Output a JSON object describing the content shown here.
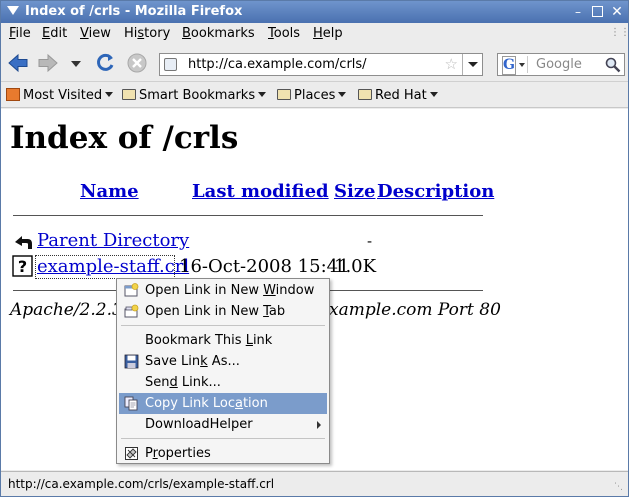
{
  "window": {
    "title": "Index of /crls - Mozilla Firefox"
  },
  "menubar": {
    "items": [
      {
        "pre": "",
        "acc": "F",
        "post": "ile"
      },
      {
        "pre": "",
        "acc": "E",
        "post": "dit"
      },
      {
        "pre": "",
        "acc": "V",
        "post": "iew"
      },
      {
        "pre": "Hi",
        "acc": "s",
        "post": "tory"
      },
      {
        "pre": "",
        "acc": "B",
        "post": "ookmarks"
      },
      {
        "pre": "",
        "acc": "T",
        "post": "ools"
      },
      {
        "pre": "",
        "acc": "H",
        "post": "elp"
      }
    ]
  },
  "navbar": {
    "url": "http://ca.example.com/crls/",
    "search_placeholder": "Google"
  },
  "bookmarks": {
    "items": [
      "Most Visited",
      "Smart Bookmarks",
      "Places",
      "Red Hat"
    ]
  },
  "page": {
    "heading": "Index of /crls",
    "columns": [
      "Name",
      "Last modified",
      "Size",
      "Description"
    ],
    "rows": [
      {
        "name": "Parent Directory",
        "modified": "",
        "size": "-",
        "icon": "back-arrow-icon"
      },
      {
        "name": "example-staff.crl",
        "modified": "16-Oct-2008 15:41",
        "size": "1.0K",
        "icon": "unknown-file-icon"
      }
    ],
    "footer_left": "Apache/2.2.3",
    "footer_right": "xample.com Port 80"
  },
  "status": {
    "text": "http://ca.example.com/crls/example-staff.crl"
  },
  "context_menu": {
    "items": [
      {
        "pre": "Open Link in New ",
        "acc": "W",
        "post": "indow",
        "icon": "new-window-icon"
      },
      {
        "pre": "Open Link in New ",
        "acc": "T",
        "post": "ab",
        "icon": "new-tab-icon"
      },
      {
        "pre": "Bookmark This ",
        "acc": "L",
        "post": "ink",
        "icon": ""
      },
      {
        "pre": "Save Lin",
        "acc": "k",
        "post": " As...",
        "icon": "save-icon"
      },
      {
        "pre": "Sen",
        "acc": "d",
        "post": " Link...",
        "icon": ""
      },
      {
        "pre": "Copy Link Loc",
        "acc": "a",
        "post": "tion",
        "icon": "copy-icon"
      },
      {
        "pre": "DownloadHelper",
        "acc": "",
        "post": "",
        "icon": ""
      },
      {
        "pre": "P",
        "acc": "r",
        "post": "operties",
        "icon": "properties-icon"
      }
    ],
    "highlighted_index": 5
  },
  "colors": {
    "titlebar": "#4a71b0",
    "link": "#0000cc",
    "menu_highlight": "#7b9ccb"
  }
}
